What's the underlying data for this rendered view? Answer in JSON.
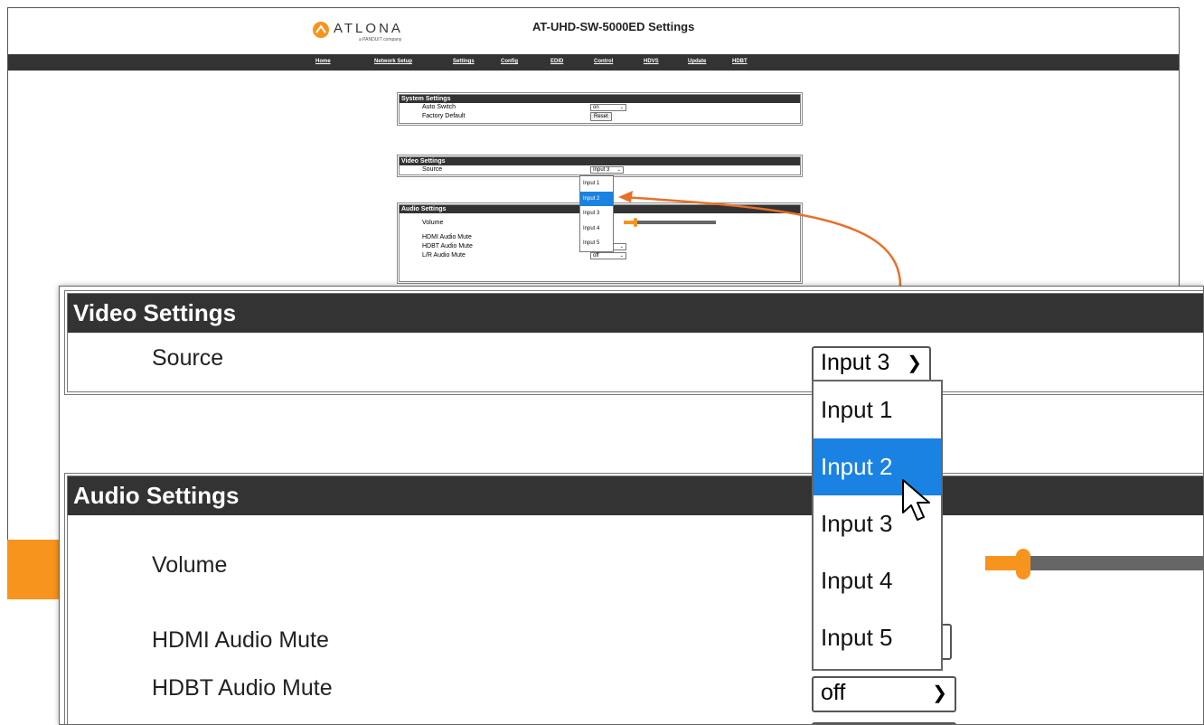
{
  "header": {
    "logo_word": "ATLONA",
    "logo_sub": "a PANDUIT company",
    "title": "AT-UHD-SW-5000ED Settings"
  },
  "nav": [
    "Home",
    "Network Setup",
    "Settings",
    "Config",
    "EDID",
    "Control",
    "HDVS",
    "Update",
    "HDBT"
  ],
  "system_settings": {
    "title": "System Settings",
    "auto_switch_label": "Auto Switch",
    "auto_switch_value": "on",
    "factory_default_label": "Factory Default",
    "reset_label": "Reset"
  },
  "video_settings": {
    "title": "Video Settings",
    "source_label": "Source",
    "source_value": "Input 3",
    "options": [
      "Input 1",
      "Input 2",
      "Input 3",
      "Input 4",
      "Input 5"
    ],
    "highlighted": "Input 2"
  },
  "audio_settings": {
    "title": "Audio Settings",
    "volume_label": "Volume",
    "volume_level_fraction": 0.1,
    "hdmi_mute_label": "HDMI Audio Mute",
    "hdbt_mute_label": "HDBT Audio Mute",
    "hdbt_mute_value": "off",
    "lr_mute_label": "L/R Audio Mute",
    "lr_mute_value": "off"
  },
  "colors": {
    "accent": "#f7941d",
    "header_bar": "#333333",
    "highlight": "#1a82e2"
  }
}
